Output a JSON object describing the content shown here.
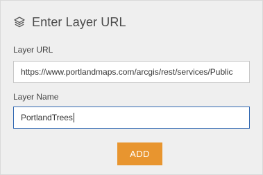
{
  "panel": {
    "title": "Enter Layer URL",
    "header_icon": "layers-icon"
  },
  "layer_url": {
    "label": "Layer URL",
    "value": "https://www.portlandmaps.com/arcgis/rest/services/Public"
  },
  "layer_name": {
    "label": "Layer Name",
    "value": "PortlandTrees"
  },
  "actions": {
    "add_label": "ADD"
  },
  "colors": {
    "accent_button": "#e8952f",
    "focus_border": "#2f67b1"
  }
}
